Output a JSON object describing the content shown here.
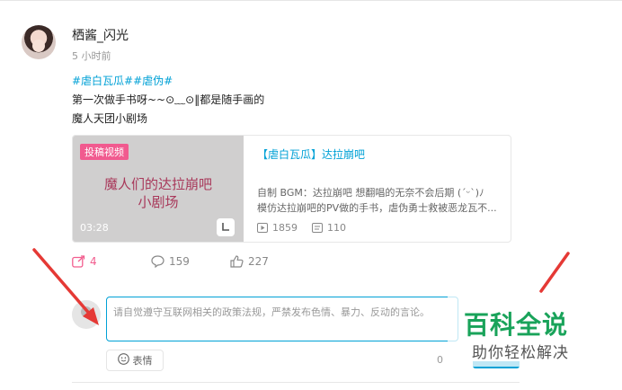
{
  "post": {
    "username": "栖酱_闪光",
    "time": "5 小时前",
    "tags": "#虐白瓦瓜##虐伪#",
    "text_line1": "第一次做手书呀~~⊙﹏⊙‖都是随手画的",
    "text_line2": "魔人天团小剧场"
  },
  "video_card": {
    "badge": "投稿视频",
    "cover_title_line1": "魔人们的达拉崩吧",
    "cover_title_line2": "小剧场",
    "duration": "03:28",
    "title": "【虐白瓦瓜】达拉崩吧",
    "desc_line1": "自制 BGM：达拉崩吧 想翻唱的无奈不会后期 (´ᵕ`)ﾉ",
    "desc_line2": "模仿达拉崩吧的PV做的手书，虐伪勇士救被恶龙瓦不...",
    "plays": "1859",
    "danmaku": "110"
  },
  "actions": {
    "share_count": "4",
    "comment_count": "159",
    "like_count": "227"
  },
  "comment": {
    "placeholder": "请自觉遵守互联网相关的政策法规，严禁发布色情、暴力、反动的言论。",
    "emoji_label": "表情",
    "char_count": "0"
  },
  "watermark": {
    "main": "百科全说",
    "sub": "助你轻松解决"
  },
  "colors": {
    "link_blue": "#00a1d6",
    "share_pink": "#f25d8e",
    "badge_pink": "#f15a8f",
    "arrow_red": "#e53935",
    "watermark_green": "#19a35a"
  },
  "icons": [
    "share-icon",
    "comment-icon",
    "like-icon",
    "play-icon",
    "danmaku-icon",
    "emoji-icon",
    "mini-player-icon"
  ]
}
